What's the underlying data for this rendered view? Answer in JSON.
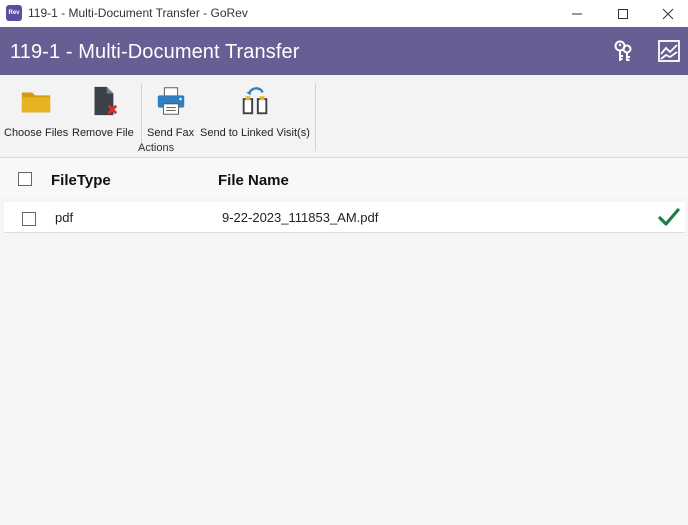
{
  "window": {
    "title": "119-1 - Multi-Document Transfer - GoRev",
    "app_icon_text": "GoRev",
    "controls": [
      "minimize",
      "maximize",
      "close"
    ]
  },
  "header": {
    "title": "119-1 - Multi-Document Transfer",
    "icons": [
      "keys-icon",
      "chart-icon"
    ]
  },
  "ribbon": {
    "buttons": [
      {
        "label": "Choose Files",
        "icon": "folder-icon"
      },
      {
        "label": "Remove File",
        "icon": "remove-file-icon"
      },
      {
        "label": "Send Fax",
        "icon": "printer-icon"
      },
      {
        "label": "Send to Linked Visit(s)",
        "icon": "transfer-icon"
      }
    ],
    "group_label": "Actions"
  },
  "grid": {
    "columns": [
      "FileType",
      "File Name"
    ],
    "rows": [
      {
        "file_type": "pdf",
        "file_name": "9-22-2023_111853_AM.pdf",
        "status": "check-icon"
      }
    ]
  },
  "colors": {
    "header_bg": "#655f93",
    "check_green": "#1e7d45",
    "folder": "#e3ac1e",
    "remove_red": "#d9302c"
  }
}
